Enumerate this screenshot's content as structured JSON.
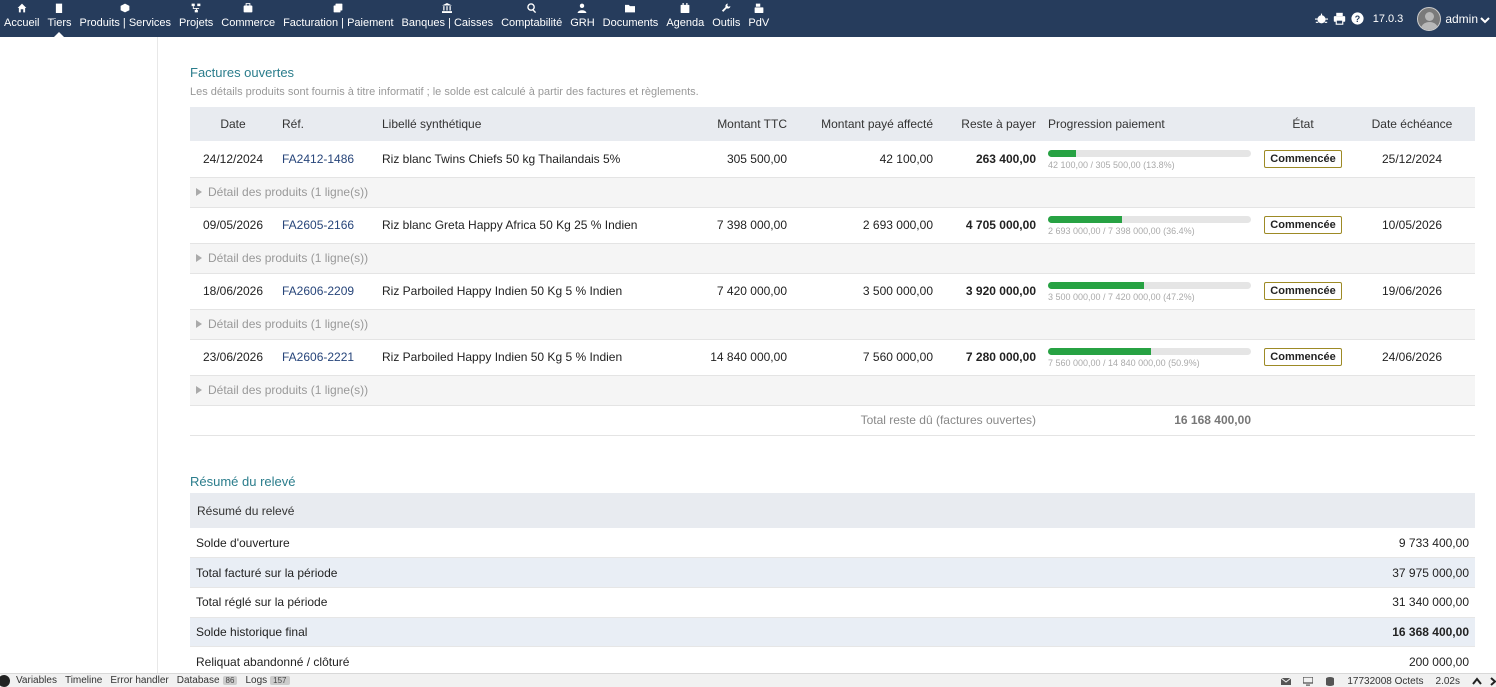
{
  "nav": {
    "items": [
      {
        "label": "Accueil",
        "icon": "home-icon"
      },
      {
        "label": "Tiers",
        "icon": "building-icon",
        "active": true
      },
      {
        "label": "Produits | Services",
        "icon": "cube-icon"
      },
      {
        "label": "Projets",
        "icon": "sitemap-icon"
      },
      {
        "label": "Commerce",
        "icon": "briefcase-icon"
      },
      {
        "label": "Facturation | Paiement",
        "icon": "invoice-icon"
      },
      {
        "label": "Banques | Caisses",
        "icon": "bank-icon"
      },
      {
        "label": "Comptabilité",
        "icon": "search-dollar-icon"
      },
      {
        "label": "GRH",
        "icon": "user-icon"
      },
      {
        "label": "Documents",
        "icon": "folder-icon"
      },
      {
        "label": "Agenda",
        "icon": "calendar-icon"
      },
      {
        "label": "Outils",
        "icon": "wrench-icon"
      },
      {
        "label": "PdV",
        "icon": "cash-register-icon"
      }
    ],
    "version": "17.0.3",
    "user": "admin"
  },
  "open_invoices": {
    "title": "Factures ouvertes",
    "subtitle": "Les détails produits sont fournis à titre informatif ; le solde est calculé à partir des factures et règlements.",
    "headers": {
      "date": "Date",
      "ref": "Réf.",
      "label": "Libellé synthétique",
      "amount": "Montant TTC",
      "paid": "Montant payé affecté",
      "remaining": "Reste à payer",
      "progress": "Progression paiement",
      "state": "État",
      "due": "Date échéance"
    },
    "rows": [
      {
        "date": "24/12/2024",
        "ref": "FA2412-1486",
        "label": "Riz blanc Twins Chiefs 50 kg Thailandais 5%",
        "amount": "305 500,00",
        "paid": "42 100,00",
        "remaining": "263 400,00",
        "progress": 0.138,
        "progress_text": "42 100,00 / 305 500,00 (13.8%)",
        "state": "Commencée",
        "due": "25/12/2024",
        "detail": "Détail des produits (1 ligne(s))"
      },
      {
        "date": "09/05/2026",
        "ref": "FA2605-2166",
        "label": "Riz blanc Greta Happy Africa 50 Kg 25 % Indien",
        "amount": "7 398 000,00",
        "paid": "2 693 000,00",
        "remaining": "4 705 000,00",
        "progress": 0.364,
        "progress_text": "2 693 000,00 / 7 398 000,00 (36.4%)",
        "state": "Commencée",
        "due": "10/05/2026",
        "detail": "Détail des produits (1 ligne(s))"
      },
      {
        "date": "18/06/2026",
        "ref": "FA2606-2209",
        "label": "Riz Parboiled Happy Indien 50 Kg 5 % Indien",
        "amount": "7 420 000,00",
        "paid": "3 500 000,00",
        "remaining": "3 920 000,00",
        "progress": 0.472,
        "progress_text": "3 500 000,00 / 7 420 000,00 (47.2%)",
        "state": "Commencée",
        "due": "19/06/2026",
        "detail": "Détail des produits (1 ligne(s))"
      },
      {
        "date": "23/06/2026",
        "ref": "FA2606-2221",
        "label": "Riz Parboiled Happy Indien 50 Kg 5 % Indien",
        "amount": "14 840 000,00",
        "paid": "7 560 000,00",
        "remaining": "7 280 000,00",
        "progress": 0.509,
        "progress_text": "7 560 000,00 / 14 840 000,00 (50.9%)",
        "state": "Commencée",
        "due": "24/06/2026",
        "detail": "Détail des produits (1 ligne(s))"
      }
    ],
    "total_label": "Total reste dû (factures ouvertes)",
    "total_value": "16 168 400,00"
  },
  "summary": {
    "title": "Résumé du relevé",
    "header": "Résumé du relevé",
    "rows": [
      {
        "label": "Solde d'ouverture",
        "value": "9 733 400,00",
        "bold": false
      },
      {
        "label": "Total facturé sur la période",
        "value": "37 975 000,00",
        "bold": false
      },
      {
        "label": "Total réglé sur la période",
        "value": "31 340 000,00",
        "bold": false
      },
      {
        "label": "Solde historique final",
        "value": "16 368 400,00",
        "bold": true
      },
      {
        "label": "Reliquat abandonné / clôturé",
        "value": "200 000,00",
        "bold": false
      }
    ]
  },
  "debugbar": {
    "items": [
      {
        "label": "Variables"
      },
      {
        "label": "Timeline"
      },
      {
        "label": "Error handler"
      },
      {
        "label": "Database",
        "count": "86"
      },
      {
        "label": "Logs",
        "count": "157"
      }
    ],
    "memory": "17732008 Octets",
    "time": "2.02s"
  },
  "colors": {
    "topbar": "#263c5c",
    "accent_title": "#2b7d8c",
    "progress_fill": "#27a243",
    "badge_border": "#9d8a25"
  }
}
